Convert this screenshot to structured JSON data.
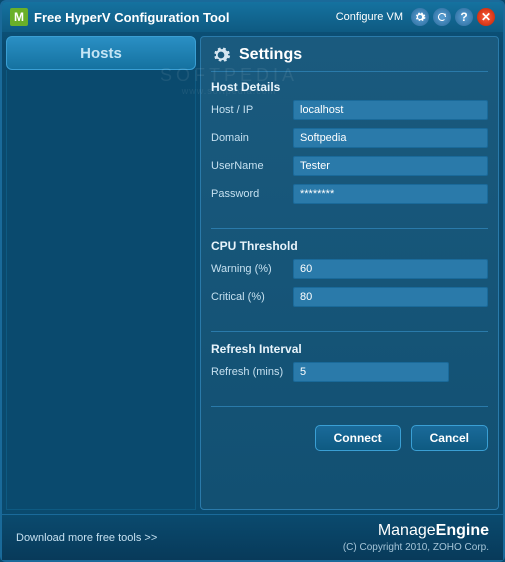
{
  "titlebar": {
    "title": "Free HyperV Configuration Tool",
    "configure_vm": "Configure VM"
  },
  "sidebar": {
    "tab_label": "Hosts"
  },
  "settings": {
    "heading": "Settings",
    "host_details": {
      "title": "Host Details",
      "host_ip_label": "Host / IP",
      "host_ip_value": "localhost",
      "domain_label": "Domain",
      "domain_value": "Softpedia",
      "username_label": "UserName",
      "username_value": "Tester",
      "password_label": "Password",
      "password_value": "********"
    },
    "cpu_threshold": {
      "title": "CPU Threshold",
      "warning_label": "Warning (%)",
      "warning_value": "60",
      "critical_label": "Critical (%)",
      "critical_value": "80"
    },
    "refresh_interval": {
      "title": "Refresh Interval",
      "refresh_label": "Refresh (mins)",
      "refresh_value": "5"
    },
    "buttons": {
      "connect": "Connect",
      "cancel": "Cancel"
    }
  },
  "footer": {
    "link": "Download more free tools >>",
    "brand_light": "Manage",
    "brand_bold": "Engine",
    "copyright": "(C) Copyright 2010, ZOHO Corp."
  },
  "watermark": {
    "line1": "SOFTPEDIA",
    "line2": "www.softpedia.com"
  }
}
